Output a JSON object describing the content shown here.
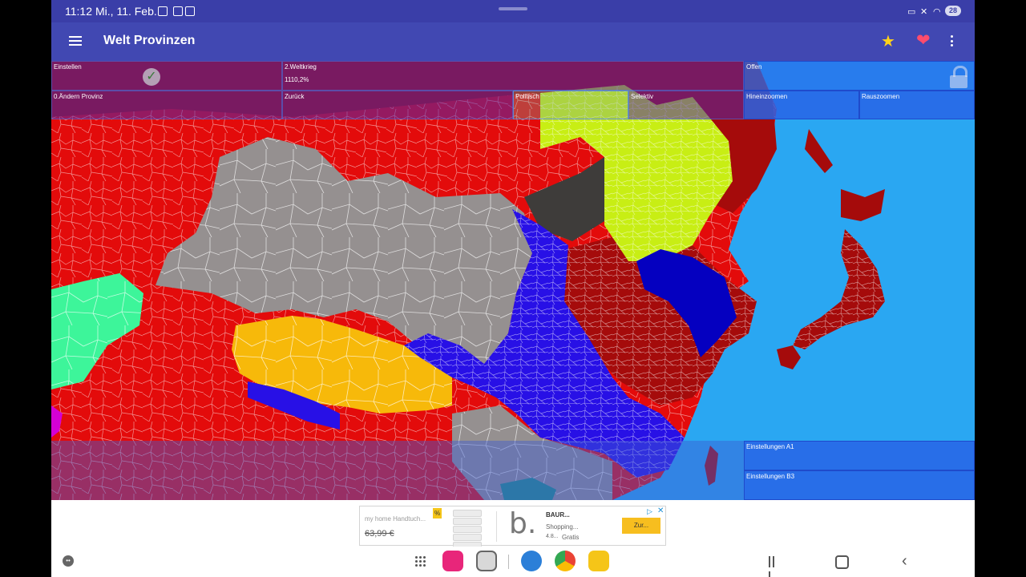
{
  "status_bar": {
    "time": "11:12",
    "date": "Mi., 11. Feb.",
    "battery": "28"
  },
  "app_bar": {
    "title": "Welt Provinzen"
  },
  "controls": {
    "settings": "Einstellen",
    "scenario": "2.Weltkrieg",
    "percentage": "1110,2%",
    "open": "Offen",
    "change_province": "0.Ändern Provinz",
    "back": "Zurück",
    "political": "Politisch",
    "selective": "Selektiv",
    "zoom_in": "Hineinzoomen",
    "zoom_out": "Rauszoomen",
    "settings_a1": "Einstellungen A1",
    "settings_b3": "Einstellungen B3"
  },
  "ad": {
    "product": "my home Handtuch...",
    "discount_badge": "%",
    "price": "63,99 €",
    "logo": "b.",
    "brand": "BAUR...",
    "category": "Shopping...",
    "rating": "4.8...",
    "free": "Gratis",
    "cta": "Zur..."
  },
  "colors": {
    "status_bar": "#3a3ea8",
    "app_bar": "#4148b2",
    "ocean": "#2aa7f2",
    "red_state": "#e30b0b",
    "dark_red_state": "#a50b0b",
    "gray_state": "#959090",
    "blue_state": "#2810e6",
    "yellow_state": "#f7b90a",
    "lime_state": "#c8ee14",
    "green_state": "#3df59a",
    "dark_gray_state": "#3e3c3a",
    "navy_state": "#0500c0"
  },
  "icons": {
    "menu": "hamburger-menu-icon",
    "favorite": "star-icon",
    "like": "heart-icon",
    "more": "more-vert-icon",
    "confirm": "check-icon",
    "lock": "lock-icon"
  }
}
